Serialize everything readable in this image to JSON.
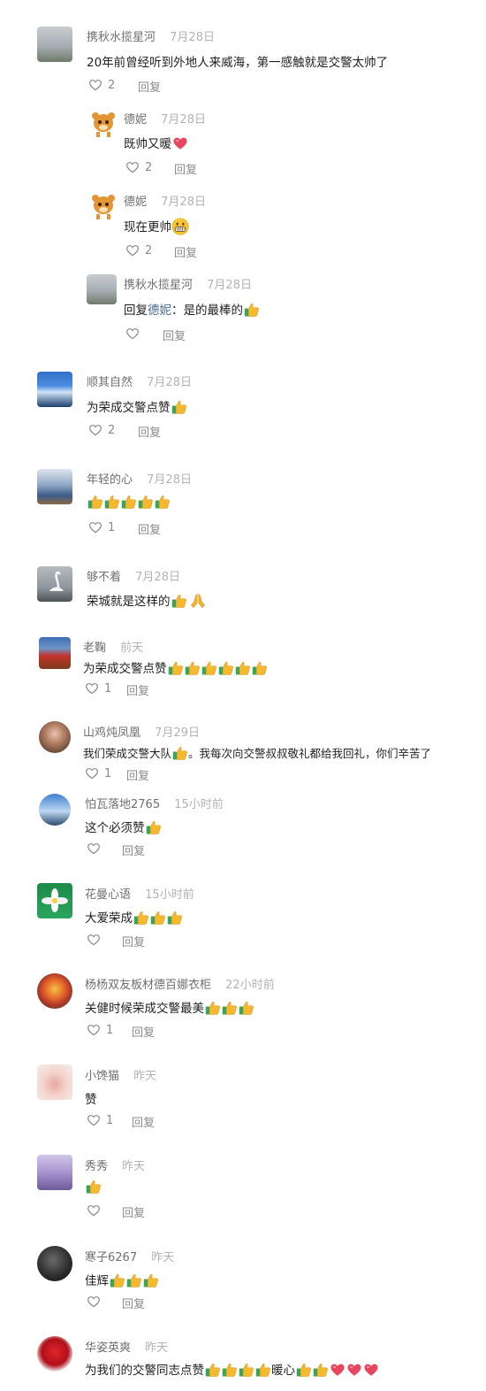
{
  "comments": [
    {
      "name": "携秋水揽星河",
      "time": "7月28日",
      "text": "20年前曾经听到外地人来威海，第一感触就是交警太帅了",
      "likes": "2",
      "reply": "回复"
    },
    {
      "name": "德妮",
      "time": "7月28日",
      "text": "既帅又暖",
      "likes": "2",
      "reply": "回复"
    },
    {
      "name": "德妮",
      "time": "7月28日",
      "text": "现在更帅",
      "likes": "2",
      "reply": "回复"
    },
    {
      "name": "携秋水揽星河",
      "time": "7月28日",
      "text_prefix": "回复",
      "reply_to": "德妮",
      "text": "：是的最棒的",
      "likes": "",
      "reply": "回复"
    },
    {
      "name": "顺其自然",
      "time": "7月28日",
      "text": "为荣成交警点赞",
      "likes": "2",
      "reply": "回复"
    },
    {
      "name": "年轻的心",
      "time": "7月28日",
      "text": "",
      "likes": "1",
      "reply": "回复"
    },
    {
      "name": "够不着",
      "time": "7月28日",
      "text": "荣城就是这样的",
      "likes": "",
      "reply": ""
    },
    {
      "name": "老鞠",
      "time": "前天",
      "text": "为荣成交警点赞",
      "likes": "1",
      "reply": "回复"
    },
    {
      "name": "山鸡炖凤凰",
      "time": "7月29日",
      "text_a": "我们荣成交警大队",
      "text_b": "。我每次向交警叔叔敬礼都给我回礼，你们辛苦了",
      "likes": "1",
      "reply": "回复"
    },
    {
      "name": "怕瓦落地2765",
      "time": "15小时前",
      "text": "这个必须赞",
      "likes": "",
      "reply": "回复"
    },
    {
      "name": "花曼心语",
      "time": "15小时前",
      "text": "大爱荣成",
      "likes": "",
      "reply": "回复"
    },
    {
      "name": "杨杨双友板材德百娜衣柜",
      "time": "22小时前",
      "text": "关健时候荣成交警最美",
      "likes": "1",
      "reply": "回复"
    },
    {
      "name": "小馋猫",
      "time": "昨天",
      "text": "赞",
      "likes": "1",
      "reply": "回复"
    },
    {
      "name": "秀秀",
      "time": "昨天",
      "text": "",
      "likes": "",
      "reply": "回复"
    },
    {
      "name": "寒子6267",
      "time": "昨天",
      "text": "佳辉",
      "likes": "",
      "reply": "回复"
    },
    {
      "name": "华姿英爽",
      "time": "昨天",
      "text_a": "为我们的交警同志点赞",
      "text_b": "暖心",
      "likes": "",
      "reply": ""
    }
  ],
  "colors": {
    "thumb": "#f5b82e",
    "cuff": "#3aa55a",
    "heart": "#e8455e",
    "meta": "#8a8a8a"
  }
}
